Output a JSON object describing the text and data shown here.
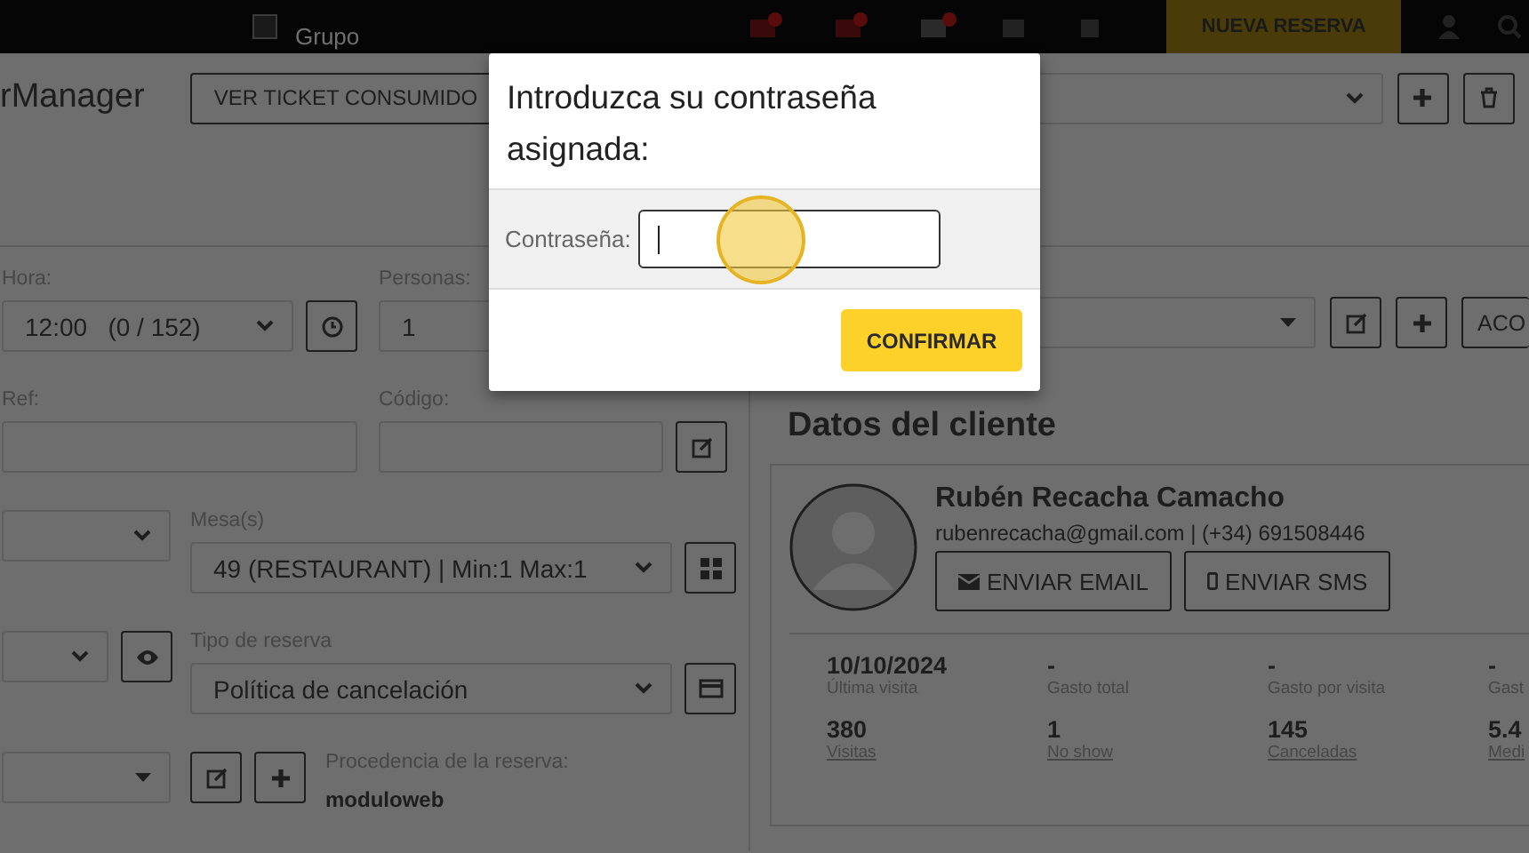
{
  "topbar": {
    "group_label": "Grupo",
    "group_checked": false,
    "new_button": "NUEVA RESERVA"
  },
  "header": {
    "title": "rManager",
    "ticket_button": "VER TICKET CONSUMIDO"
  },
  "form": {
    "hora_label": "Hora:",
    "hora_value": "12:00   (0 / 152)",
    "personas_label": "Personas:",
    "personas_value": "1",
    "ref_label": "Ref:",
    "codigo_label": "Código:",
    "mesa_label": "Mesa(s)",
    "mesa_value": "49 (RESTAURANT) | Min:1 Max:1",
    "tipo_label": "Tipo de reserva",
    "tipo_value": "Política de cancelación",
    "procedencia_label": "Procedencia de la reserva:",
    "procedencia_value": "moduloweb"
  },
  "side": {
    "accept_button": "ACO"
  },
  "client": {
    "title": "Datos del cliente",
    "name": "Rubén Recacha Camacho",
    "contact": "rubenrecacha@gmail.com | (+34) 691508446",
    "email_button": "ENVIAR EMAIL",
    "sms_button": "ENVIAR SMS",
    "stats": [
      {
        "value": "10/10/2024",
        "label": "Última visita",
        "kind": "plain"
      },
      {
        "value": "-",
        "label": "Gasto total",
        "kind": "plain"
      },
      {
        "value": "-",
        "label": "Gasto por visita",
        "kind": "plain"
      },
      {
        "value": "-",
        "label": "Gast",
        "kind": "plain"
      },
      {
        "value": "380",
        "label": "Visitas",
        "kind": "link"
      },
      {
        "value": "1",
        "label": "No show",
        "kind": "link"
      },
      {
        "value": "145",
        "label": "Canceladas",
        "kind": "link"
      },
      {
        "value": "5.4",
        "label": "Medi",
        "kind": "link"
      }
    ]
  },
  "modal": {
    "title": "Introduzca su contraseña asignada:",
    "field_label": "Contraseña:",
    "confirm_button": "CONFIRMAR"
  }
}
